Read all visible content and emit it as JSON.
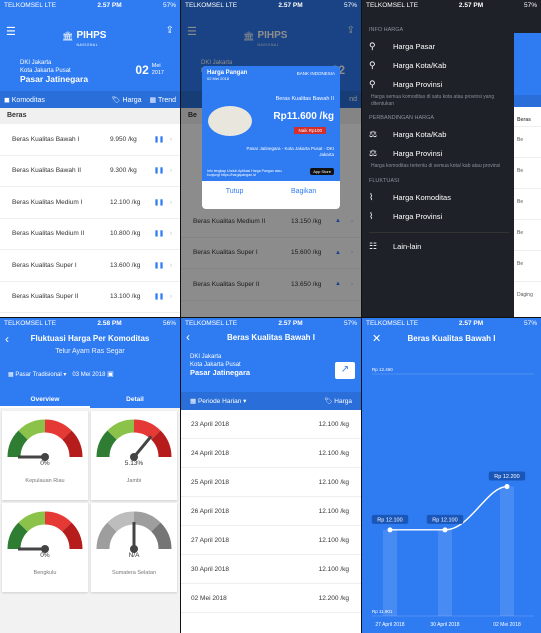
{
  "status": {
    "carrier": "TELKOMSEL",
    "net": "LTE",
    "battery": "57%",
    "battery4": "56%",
    "time1": "2.57 PM",
    "time2": "2.57 PM",
    "time3": "2.57 PM",
    "time4": "2.58 PM",
    "time5": "2.57 PM",
    "time6": "2.57 PM"
  },
  "app": {
    "logo_title": "PIHPS",
    "logo_sub": "NASIONAL"
  },
  "home": {
    "province": "DKI Jakarta",
    "city": "Kota Jakarta Pusat",
    "market": "Pasar Jatinegara",
    "day": "02",
    "month": "Mei",
    "year": "2017",
    "tab_komoditas": "Komoditas",
    "tab_harga": "Harga",
    "tab_trend": "Trend",
    "section": "Beras",
    "rows": [
      {
        "name": "Beras Kualitas Bawah I",
        "price": "9.950 /kg"
      },
      {
        "name": "Beras Kualitas Bawah II",
        "price": "9.300 /kg"
      },
      {
        "name": "Beras Kualitas Medium I",
        "price": "12.100 /kg"
      },
      {
        "name": "Beras Kualitas Medium II",
        "price": "10.800 /kg"
      },
      {
        "name": "Beras Kualitas Super I",
        "price": "13.600 /kg"
      },
      {
        "name": "Beras Kualitas Super II",
        "price": "13.100 /kg"
      }
    ]
  },
  "popup": {
    "title": "Harga Pangan",
    "date": "02 Mei 2018",
    "bank": "BANK INDONESIA",
    "product": "Beras Kualitas Bawah II",
    "price": "Rp11.600 /kg",
    "change": "Naik Rp100",
    "location": "Pasar Jatinegara - Kota Jakarta Pusat - DKI Jakarta",
    "footer": "Info lengkap Unduh Aplikasi Harga Pangan atau kunjungi https://hargapangan.id",
    "appstore": "App Store",
    "cancel": "Tutup",
    "share": "Bagikan",
    "bg_rows": [
      {
        "name": "Beras Kualitas Medium II",
        "price": "13.150 /kg"
      },
      {
        "name": "Beras Kualitas Super I",
        "price": "15.600 /kg"
      },
      {
        "name": "Beras Kualitas Super II",
        "price": "13.650 /kg"
      }
    ],
    "bg_tab": "nd",
    "bg_section": "Be",
    "bg_peek_row": "Be"
  },
  "drawer": {
    "g1": "INFO HARGA",
    "i1": "Harga Pasar",
    "i2": "Harga Kota/Kab",
    "i3": "Harga Provinsi",
    "d1": "Harga semua komoditas di satu kota atau provinsi yang ditentukan",
    "g2": "PERBANDINGAN HARGA",
    "i4": "Harga Kota/Kab",
    "i5": "Harga Provinsi",
    "d2": "Harga komoditas tertentu di semua kota/ kab atau provinsi",
    "g3": "FLUKTUASI",
    "i6": "Harga Komoditas",
    "i7": "Harga Provinsi",
    "i8": "Lain-lain",
    "peek_section": "Beras",
    "peek_foot": "Daging"
  },
  "fluk": {
    "title": "Fluktuasi Harga Per Komoditas",
    "subtitle": "Telur Ayam Ras Segar",
    "market_type": "Pasar Tradisional",
    "date": "03 Mei 2018",
    "tab_overview": "Overview",
    "tab_detail": "Detail",
    "gauges": [
      {
        "pct": "0%",
        "name": "Kepulauan Riau",
        "value": 0.0,
        "color": "color"
      },
      {
        "pct": "5.13%",
        "name": "Jambi",
        "value": 0.72,
        "color": "color"
      },
      {
        "pct": "0%",
        "name": "Bengkulu",
        "value": 0.0,
        "color": "color"
      },
      {
        "pct": "N/A",
        "name": "Sumatera Selatan",
        "value": 0.5,
        "color": "gray"
      }
    ]
  },
  "hist": {
    "title": "Beras Kualitas Bawah I",
    "province": "DKI Jakarta",
    "city": "Kota Jakarta Pusat",
    "market": "Pasar Jatinegara",
    "period": "Periode Harian",
    "harga": "Harga",
    "rows": [
      {
        "date": "23 April 2018",
        "price": "12.100 /kg"
      },
      {
        "date": "24 April 2018",
        "price": "12.100 /kg"
      },
      {
        "date": "25 April 2018",
        "price": "12.100 /kg"
      },
      {
        "date": "26 April 2018",
        "price": "12.100 /kg"
      },
      {
        "date": "27 April 2018",
        "price": "12.100 /kg"
      },
      {
        "date": "30 April 2018",
        "price": "12.100 /kg"
      },
      {
        "date": "02 Mei 2018",
        "price": "12.200 /kg"
      }
    ]
  },
  "chart_data": {
    "type": "line",
    "title": "Beras Kualitas Bawah I",
    "x": [
      "27 April 2018",
      "30 April 2018",
      "02 Mei 2018"
    ],
    "values": [
      12100,
      12100,
      12200
    ],
    "labels": [
      "Rp 12.100",
      "Rp 12.100",
      "Rp 12.200"
    ],
    "ytop": "Rp 12.460",
    "ybottom": "Rp 11.901",
    "ylim": [
      11901,
      12460
    ]
  }
}
